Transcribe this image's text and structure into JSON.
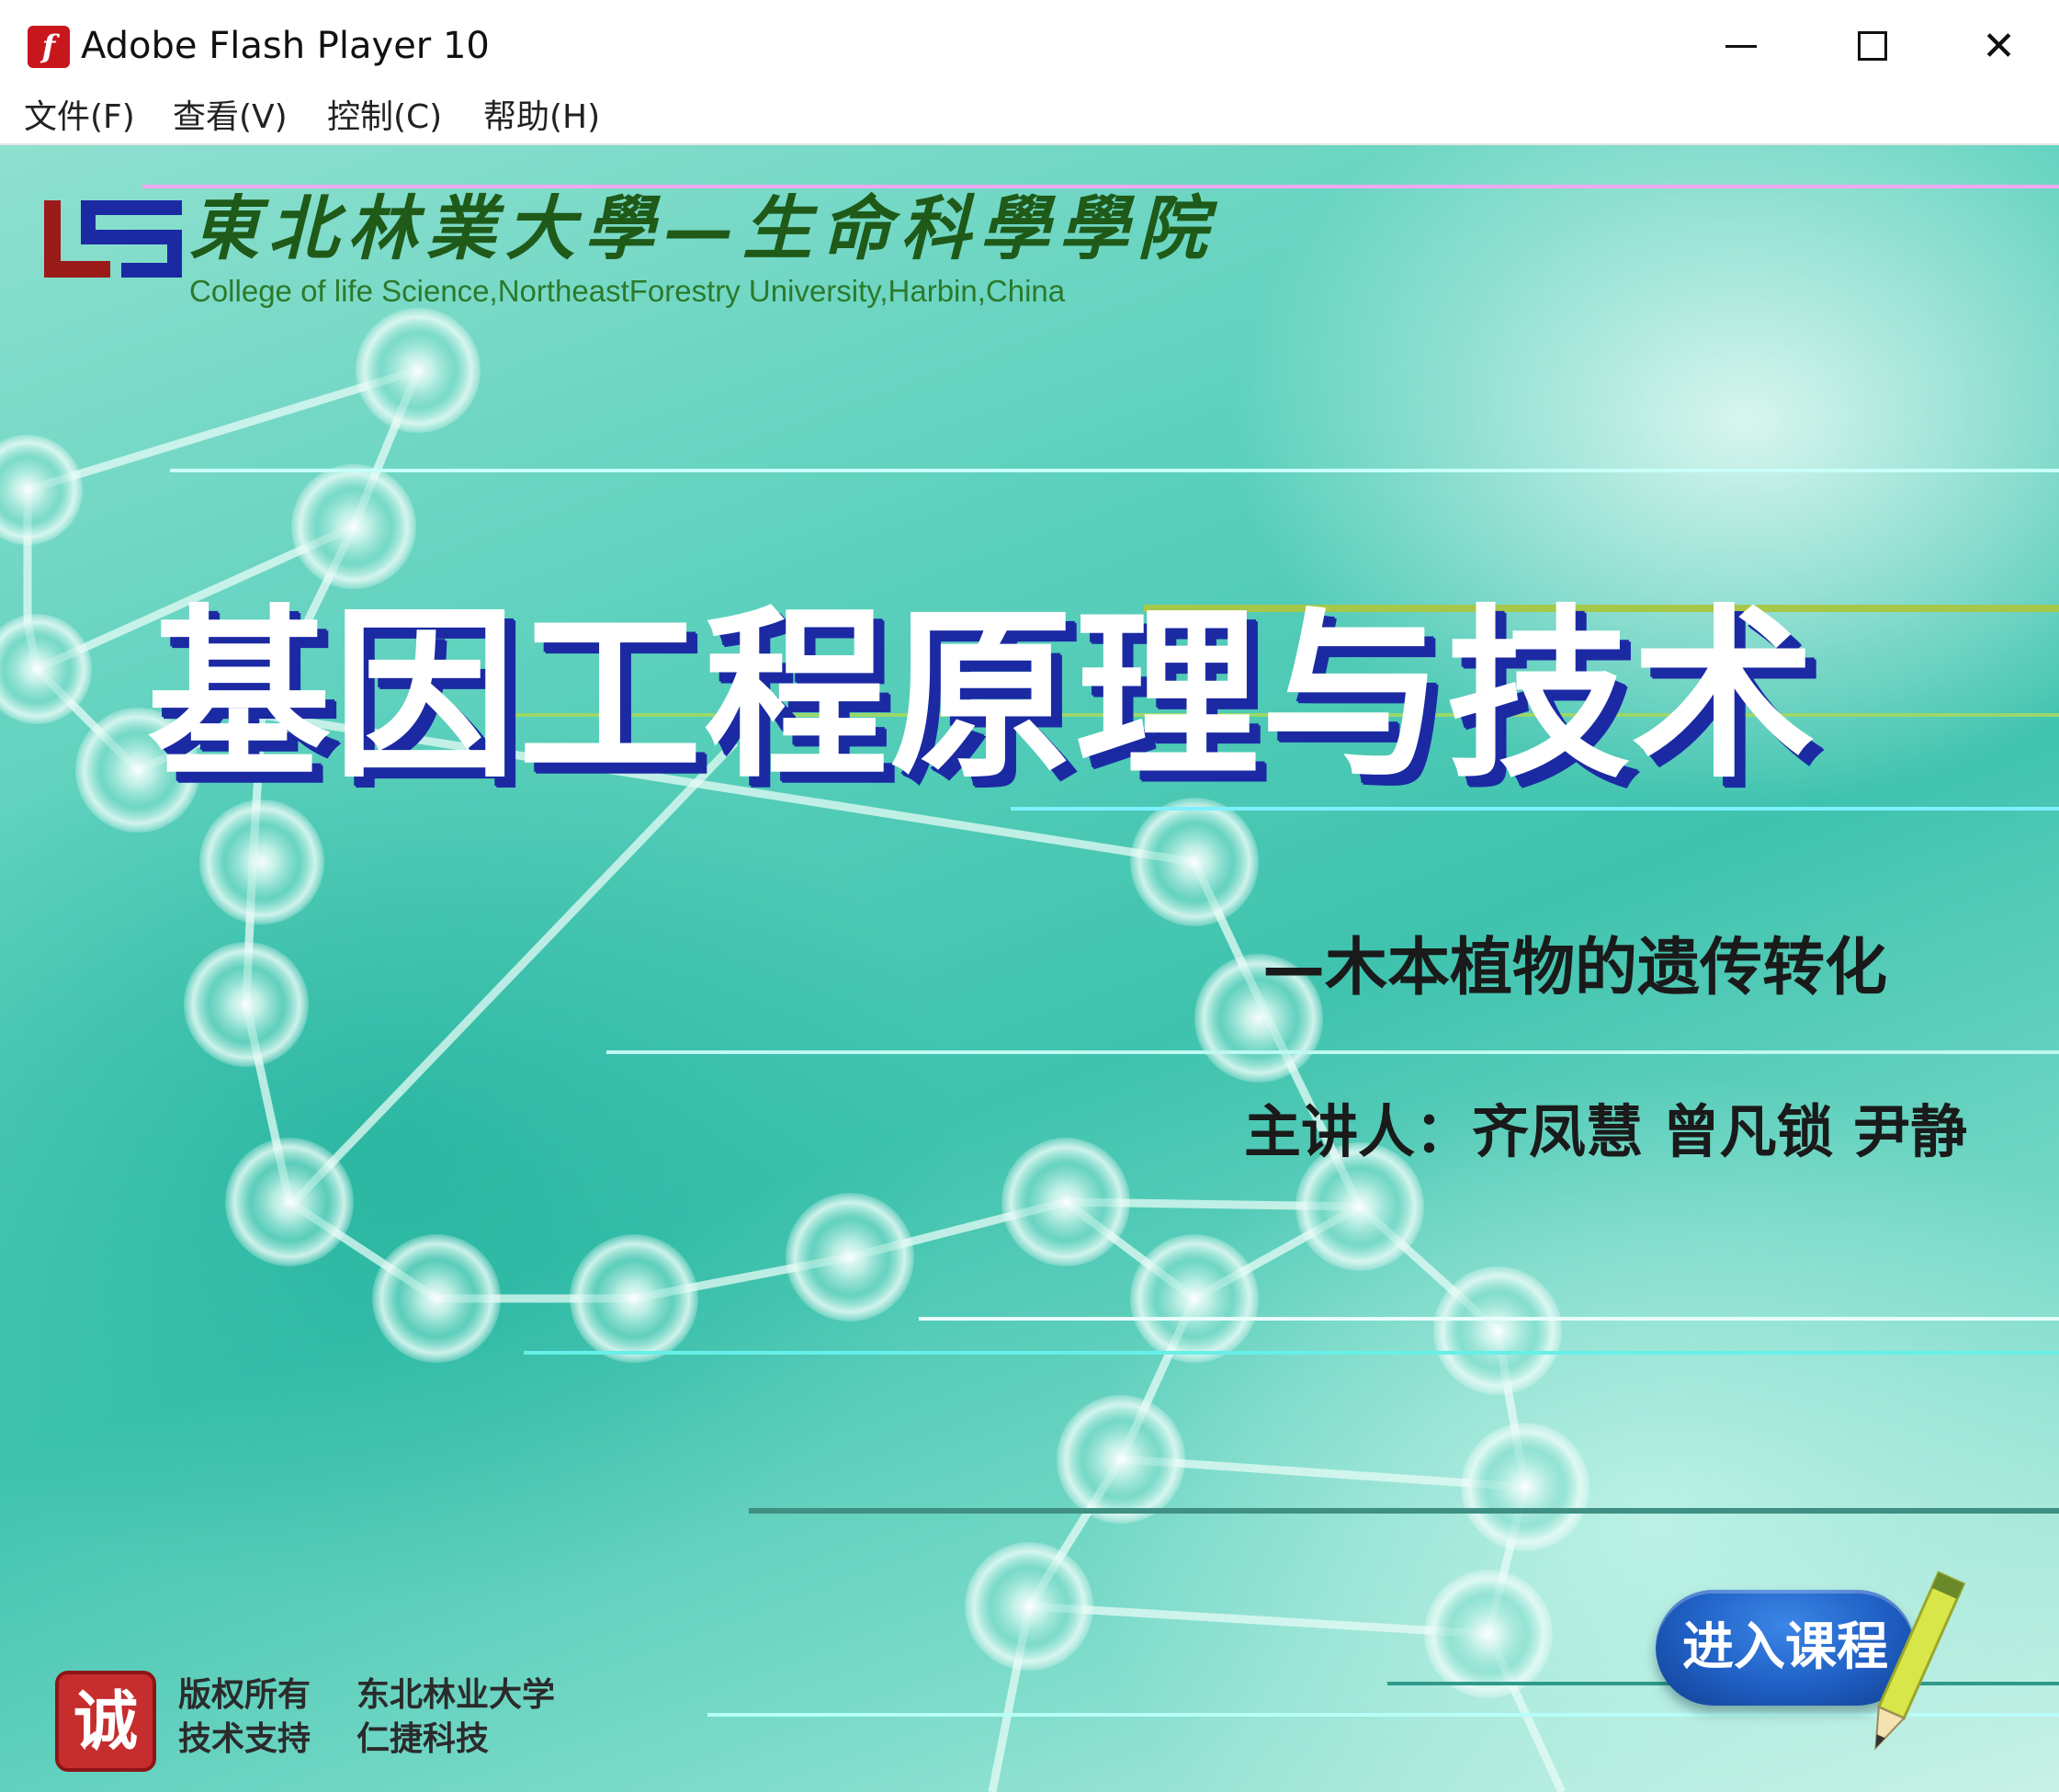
{
  "window": {
    "title": "Adobe Flash Player 10",
    "icon": "flash-player-icon",
    "icon_glyph": "f",
    "controls": {
      "minimize": "minimize-icon",
      "maximize": "maximize-icon",
      "close": "close-icon",
      "close_glyph": "✕"
    }
  },
  "menu": {
    "items": [
      {
        "label": "文件(F)"
      },
      {
        "label": "查看(V)"
      },
      {
        "label": "控制(C)"
      },
      {
        "label": "帮助(H)"
      }
    ]
  },
  "header": {
    "university_name": "東北林業大學—生命科學學院",
    "college_en": "College of life Science,NortheastForestry University,Harbin,China",
    "logo_icon": "university-logo-icon"
  },
  "course": {
    "title": "基因工程原理与技术",
    "subtitle": "—木本植物的遗传转化",
    "presenters": "主讲人：齐凤慧  曾凡锁  尹静"
  },
  "footer": {
    "seal_glyph": "诚",
    "copyright_label": "版权所有",
    "copyright_value": "东北林业大学",
    "support_label": "技术支持",
    "support_value": "仁捷科技"
  },
  "enter_button": {
    "label": "进入课程",
    "icon": "pencil-icon"
  },
  "colors": {
    "background_teal": "#3fc3ae",
    "title_shadow_blue": "#1b2aa3",
    "header_green": "#1f5a19",
    "logo_red": "#9b1b1b",
    "logo_blue": "#1b2aa3",
    "button_blue": "#1f5fc4",
    "seal_red": "#c62d2d"
  }
}
